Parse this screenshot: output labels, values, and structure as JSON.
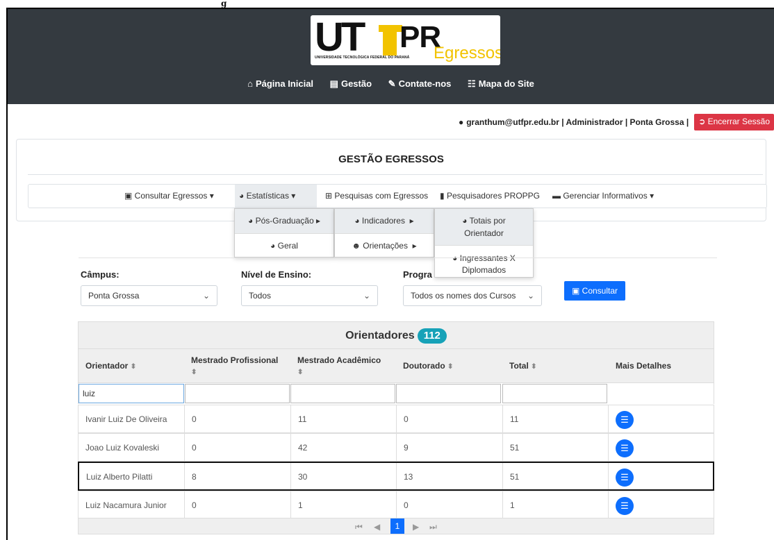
{
  "frame_label": "g",
  "logo": {
    "ut": "UT",
    "pr": "PR",
    "sub": "UNIVERSIDADE TECNOLÓGICA FEDERAL DO PARANÁ",
    "egressos": "Egressos"
  },
  "topnav": [
    {
      "icon": "home-icon",
      "label": "Página Inicial"
    },
    {
      "icon": "institution-icon",
      "label": "Gestão"
    },
    {
      "icon": "edit-icon",
      "label": "Contate-nos"
    },
    {
      "icon": "sitemap-icon",
      "label": "Mapa do Site"
    }
  ],
  "user": {
    "info": "granthum@utfpr.edu.br | Administrador | Ponta Grossa |",
    "logout": "Encerrar Sessão"
  },
  "card": {
    "title": "GESTÃO EGRESSOS"
  },
  "subnav": {
    "consultar": "Consultar Egressos",
    "estatisticas": "Estatísticas",
    "pesquisas": "Pesquisas com Egressos",
    "pesquisadores": "Pesquisadores PROPPG",
    "informativos": "Gerenciar Informativos"
  },
  "menu1": {
    "pos": "Pós-Graduação",
    "geral": "Geral"
  },
  "menu2": {
    "indicadores": "Indicadores",
    "orientacoes": "Orientações"
  },
  "menu3": {
    "totais_1": "Totais por",
    "totais_2": "Orientador",
    "ingressantes_1": "Ingressantes X",
    "ingressantes_2": "Diplomados"
  },
  "filters": {
    "campus_label": "Câmpus:",
    "campus_value": "Ponta Grossa",
    "nivel_label": "Nível de Ensino:",
    "nivel_value": "Todos",
    "programa_label": "Progra",
    "programa_value": "Todos os nomes dos Cursos",
    "consultar": "Consultar"
  },
  "table": {
    "caption": "Orientadores",
    "count": "112",
    "headers": {
      "orientador": "Orientador",
      "mp": "Mestrado Profissional",
      "ma": "Mestrado Acadêmico",
      "doutorado": "Doutorado",
      "total": "Total",
      "detalhes": "Mais Detalhes"
    },
    "filter_value": "luiz",
    "rows": [
      {
        "nome": "Ivanir Luiz De Oliveira",
        "mp": "0",
        "ma": "11",
        "dout": "0",
        "total": "11"
      },
      {
        "nome": "Joao Luiz Kovaleski",
        "mp": "0",
        "ma": "42",
        "dout": "9",
        "total": "51"
      },
      {
        "nome": "Luiz Alberto Pilatti",
        "mp": "8",
        "ma": "30",
        "dout": "13",
        "total": "51"
      },
      {
        "nome": "Luiz Nacamura Junior",
        "mp": "0",
        "ma": "1",
        "dout": "0",
        "total": "1"
      }
    ],
    "page": "1"
  }
}
